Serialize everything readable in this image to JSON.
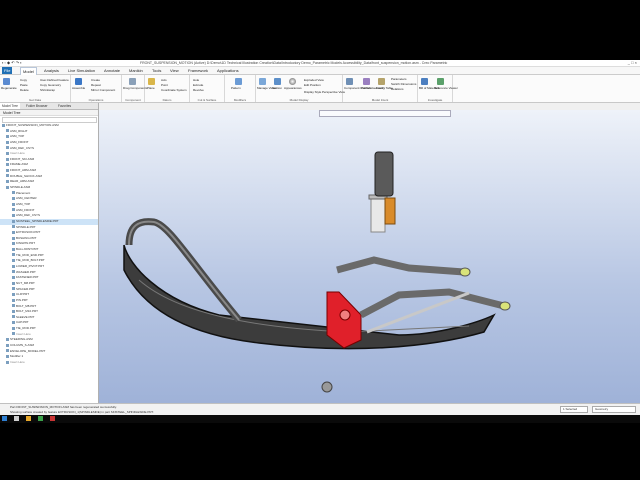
{
  "window": {
    "title": "FRONT_SUSPENSION_MOTION (Active) D:\\Demo\\1D Technical Illustration Creation\\Data\\Introductory Demo_Parametric Models Accessibility_Data\\front_suspension_motion.asm - Creo Parametric",
    "controls": [
      "_",
      "□",
      "×"
    ]
  },
  "menu_tabs": [
    "File",
    "Model",
    "Analysis",
    "Live Simulation",
    "Annotate",
    "Manikin",
    "Tools",
    "View",
    "Framework",
    "Applications"
  ],
  "active_tab": "Model",
  "ribbon": {
    "groups": [
      {
        "label": "Get Data",
        "buttons": [
          "Regenerate",
          "Copy",
          "Paste",
          "Delete",
          "User-Defined Feature",
          "Copy Geometry",
          "Shrinkwrap"
        ]
      },
      {
        "label": "Operations",
        "buttons": [
          "Assemble",
          "Create",
          "Repeat",
          "Mirror Component"
        ]
      },
      {
        "label": "Component",
        "buttons": [
          "Drag Components"
        ]
      },
      {
        "label": "Datum",
        "buttons": [
          "Plane",
          "Axis",
          "Point",
          "Coordinate System"
        ]
      },
      {
        "label": "Cut & Surface",
        "buttons": [
          "Hole",
          "Extrude",
          "Revolve"
        ]
      },
      {
        "label": "Modifiers",
        "buttons": [
          "Pattern"
        ]
      },
      {
        "label": "Model Display",
        "buttons": [
          "Manage Views",
          "Section",
          "Appearances",
          "Exploded View",
          "Edit Position",
          "Display Style",
          "Perspective View"
        ]
      },
      {
        "label": "Model Intent",
        "buttons": [
          "Component Interface",
          "Publish Geometry",
          "Family Table",
          "Parameters",
          "Switch Dimensions",
          "Relations"
        ]
      },
      {
        "label": "Investigate",
        "buttons": [
          "Bill of Materials",
          "Reference Viewer"
        ]
      }
    ]
  },
  "side_panel": {
    "tabs": [
      "Model Tree",
      "Folder Browser",
      "Favorites"
    ],
    "header": "Model Tree",
    "tree_items": [
      "FRONT_SUSPENSION_MOTION.ASM",
      "ASM_RIGHT",
      "ASM_TOP",
      "ASM_FRONT",
      "ASM_DEF_CSYS",
      "Insert Here",
      "FRONT_SKI.ASM",
      "FRAME.ASM",
      "FRONT_ARM.ASM",
      "DOUBLE_SHOCK.ASM",
      "REAR_ARM.ASM",
      "SPINDLE.ASM",
      "Placement",
      "ASM_CENTER",
      "ASM_TOP",
      "ASM_FRONT",
      "ASM_DEF_CSYS",
      "SKISTEEL_SPINDLESIDE.PRT",
      "SPINDLE.PRT",
      "EXTRUSION.PRT",
      "BUSHING.PRT",
      "KINGPIN.PRT",
      "BALLJOINT.PRT",
      "TIE_ROD_END.PRT",
      "TIE_ROD_BOLT.PRT",
      "LOWER_PIVOT.PRT",
      "WASHER.PRT",
      "FASTENER.PRT",
      "NUT_M8.PRT",
      "SPACER.PRT",
      "CLIP.PRT",
      "PIN.PRT",
      "BOLT_M8.PRT",
      "BOLT_M10.PRT",
      "SLEEVE.PRT",
      "CAP.PRT",
      "TIE_ROD.PRT",
      "Insert Here",
      "STEERING.ASM",
      "COLUMN_S.ASM",
      "ENVELOPE_MODEL.PRT",
      "Modifier 1",
      "Insert Here"
    ],
    "selected_index": 17
  },
  "status": {
    "messages": [
      "Part FRONT_SUSPENSION_MOTION.ASM has been regenerated successfully.",
      "Showing surface created by feature EXTRUSION_1(SPINDLESIDE) in part SKISTEEL_SPINDLESIDE.PRT."
    ],
    "selection": "1 Selected",
    "filter": "Geometry"
  },
  "colors": {
    "accent": "#1f6fb5",
    "viewport_top": "#eef2f9",
    "viewport_bottom": "#9fb2d8",
    "highlight_red": "#e0202a"
  }
}
